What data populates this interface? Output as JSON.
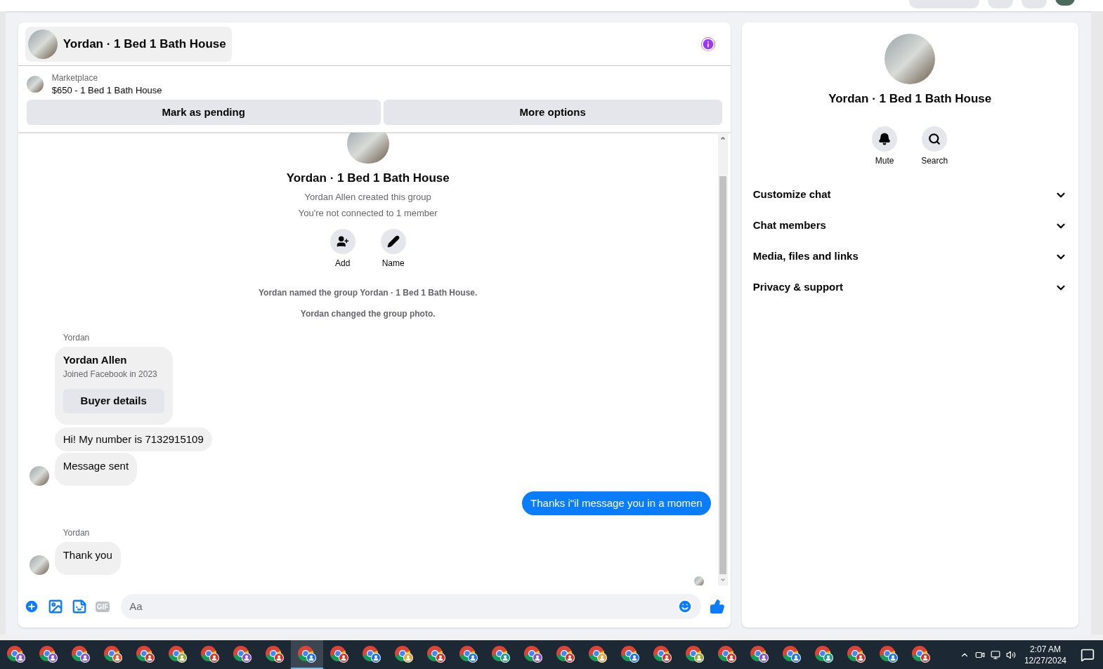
{
  "chat": {
    "title": "Yordan · 1 Bed 1 Bath House",
    "listing": {
      "source": "Marketplace",
      "title": "$650 - 1 Bed 1 Bath House"
    },
    "actions": [
      "Mark as pending",
      "More options"
    ],
    "intro": {
      "title": "Yordan · 1 Bed 1 Bath House",
      "lines": [
        "Yordan Allen created this group",
        "You're not connected to 1 member"
      ],
      "buttons": [
        {
          "kind": "add",
          "label": "Add"
        },
        {
          "kind": "name",
          "label": "Name"
        }
      ]
    },
    "messages": [
      {
        "kind": "system",
        "text": "Yordan named the group Yordan · 1 Bed 1 Bath House."
      },
      {
        "kind": "system",
        "text": "Yordan changed the group photo."
      },
      {
        "kind": "sender",
        "text": "Yordan"
      },
      {
        "kind": "card",
        "name": "Yordan Allen",
        "subtitle": "Joined Facebook in 2023",
        "button": "Buyer details"
      },
      {
        "kind": "incoming",
        "text": "Hi! My number is 7132915109",
        "avatar": false
      },
      {
        "kind": "incoming",
        "text": "Message sent",
        "avatar": true
      },
      {
        "kind": "outgoing",
        "text": "Thanks i\"il message you in a momen"
      },
      {
        "kind": "sender",
        "text": "Yordan"
      },
      {
        "kind": "incoming",
        "text": "Thank you",
        "avatar": true
      }
    ],
    "composer": {
      "placeholder": "Aa",
      "gif": "GIF"
    }
  },
  "details": {
    "title": "Yordan · 1 Bed 1 Bath House",
    "buttons": [
      {
        "kind": "mute",
        "label": "Mute"
      },
      {
        "kind": "search",
        "label": "Search"
      }
    ],
    "sections": [
      {
        "label": "Customize chat",
        "expanded": false
      },
      {
        "label": "Chat members",
        "expanded": false
      },
      {
        "label": "Media, files and links",
        "expanded": false
      },
      {
        "label": "Privacy & support",
        "expanded": false
      }
    ]
  },
  "taskbar": {
    "apps": [
      {
        "color": "#8a4fd0",
        "selected": false
      },
      {
        "color": "#8a4fd0",
        "selected": false
      },
      {
        "color": "#8a4fd0",
        "selected": false
      },
      {
        "color": "#e05a2b",
        "selected": false
      },
      {
        "color": "#d93025",
        "selected": false
      },
      {
        "color": "#9aa83a",
        "selected": false
      },
      {
        "color": "#d93025",
        "selected": false
      },
      {
        "color": "#8a4fd0",
        "selected": false
      },
      {
        "color": "#d93025",
        "selected": false
      },
      {
        "color": "#1a73e8",
        "selected": true
      },
      {
        "color": "#d93025",
        "selected": false
      },
      {
        "color": "#1a73e8",
        "selected": false
      },
      {
        "color": "#e8a33a",
        "selected": false
      },
      {
        "color": "#d93025",
        "selected": false
      },
      {
        "color": "#1a73e8",
        "selected": false
      },
      {
        "color": "#1a9e8a",
        "selected": false
      },
      {
        "color": "#8a4fd0",
        "selected": false
      },
      {
        "color": "#d93025",
        "selected": false
      },
      {
        "color": "#e8a33a",
        "selected": false
      },
      {
        "color": "#1a73e8",
        "selected": false
      },
      {
        "color": "#d93025",
        "selected": false
      },
      {
        "color": "#9aa83a",
        "selected": false
      },
      {
        "color": "#d93025",
        "selected": false
      },
      {
        "color": "#8a4fd0",
        "selected": false
      },
      {
        "color": "#1a73e8",
        "selected": false
      },
      {
        "color": "#1a9e8a",
        "selected": false
      },
      {
        "color": "#d93025",
        "selected": false
      },
      {
        "color": "#1a73e8",
        "selected": false
      },
      {
        "color": "#d93025",
        "selected": false
      }
    ],
    "time": "2:07 AM",
    "date": "12/27/2024"
  }
}
